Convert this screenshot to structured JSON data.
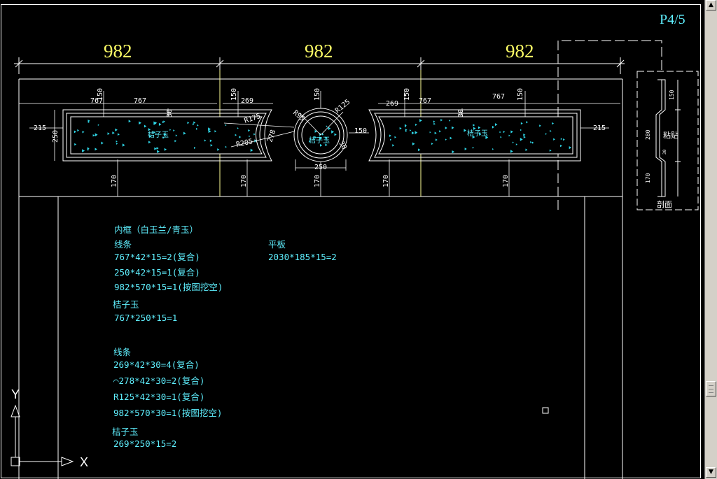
{
  "page_label": "P4/5",
  "colors": {
    "background": "#000000",
    "dimension": "#ffffff",
    "big_dimension": "#ffff66",
    "annotation": "#5ff0ff",
    "frame_yellow": "#ffff99"
  },
  "top_dims": [
    "982",
    "982",
    "982"
  ],
  "dims": {
    "d767_left": "767",
    "d767_left_b": "767",
    "d150_a": "150",
    "d150_b": "150",
    "d269_left": "269",
    "d30_left": "30",
    "d215_left": "215",
    "d250_left": "250",
    "r175": "R175",
    "r205": "R205",
    "d278": "278",
    "r95": "R95",
    "r125": "R125",
    "d150_top_circle": "150",
    "d30_circle": "30",
    "d250_circle": "250",
    "d150_right_circle": "150",
    "d269_right": "269",
    "d150_c": "150",
    "d767_right": "767",
    "d767_right_b": "767",
    "d150_d": "150",
    "d30_right": "30",
    "d215_right": "215",
    "d170_1": "170",
    "d170_2": "170",
    "d170_3": "170",
    "d170_4": "170",
    "d170_5": "170"
  },
  "inset_labels": {
    "left_panel": "桔子玉",
    "circle": "桔子玉",
    "right_panel": "桔子玉"
  },
  "section": {
    "label": "剖面",
    "side_label": "粘贴",
    "d150": "150",
    "d280": "280",
    "d170": "170",
    "d30": "30"
  },
  "notes_left": [
    "内框（白玉兰/青玉）",
    "线条",
    "767*42*15=2(复合)",
    "250*42*15=1(复合)",
    "982*570*15=1(按图挖空)",
    "桔子玉",
    "767*250*15=1",
    "线条",
    "269*42*30=4(复合)",
    "⌒278*42*30=2(复合)",
    "R125*42*30=1(复合)",
    "982*570*30=1(按图挖空)",
    "桔子玉",
    "269*250*15=2"
  ],
  "notes_right": [
    "平板",
    "2030*185*15=2"
  ],
  "ucs": {
    "x_label": "X",
    "y_label": "Y"
  },
  "scrollbar": {
    "up": "▲",
    "down": "▼"
  }
}
